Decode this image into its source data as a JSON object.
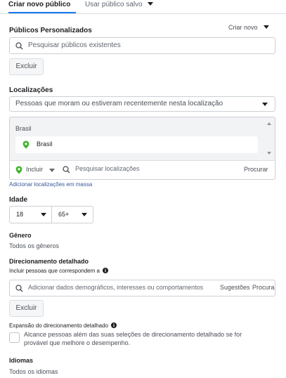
{
  "tabs": {
    "create_new": "Criar novo público",
    "use_saved": "Usar público salvo"
  },
  "custom_audiences": {
    "title": "Públicos Personalizados",
    "create_new_dropdown": "Criar novo",
    "search_placeholder": "Pesquisar públicos existentes",
    "exclude_button": "Excluir"
  },
  "locations": {
    "title": "Localizações",
    "people_filter": "Pessoas que moram ou estiveram recentemente nesta localização",
    "group_header": "Brasil",
    "selected_location": "Brasil",
    "include_dropdown": "Incluir",
    "search_placeholder": "Pesquisar localizações",
    "browse_button": "Procurar",
    "bulk_link": "Adicionar localizações em massa"
  },
  "age": {
    "title": "Idade",
    "min": "18",
    "max": "65+"
  },
  "gender": {
    "title": "Gênero",
    "value": "Todos os gêneros"
  },
  "detailed_targeting": {
    "title": "Direcionamento detalhado",
    "include_label": "Incluir pessoas que correspondem a",
    "search_placeholder": "Adicionar dados demográficos, interesses ou comportamentos",
    "suggestions_button": "Sugestões",
    "browse_button": "Procurar",
    "exclude_button": "Excluir",
    "expansion_title": "Expansão do direcionamento detalhado",
    "expansion_text_line1": "Alcance pessoas além das suas seleções de direcionamento detalhado se for",
    "expansion_text_line2": "provável que melhore o desempenho."
  },
  "languages": {
    "title": "Idiomas",
    "value": "Todos os idiomas"
  },
  "colors": {
    "accent_blue": "#1877f2",
    "pin_green": "#42b72a",
    "border": "#ccd0d5"
  }
}
